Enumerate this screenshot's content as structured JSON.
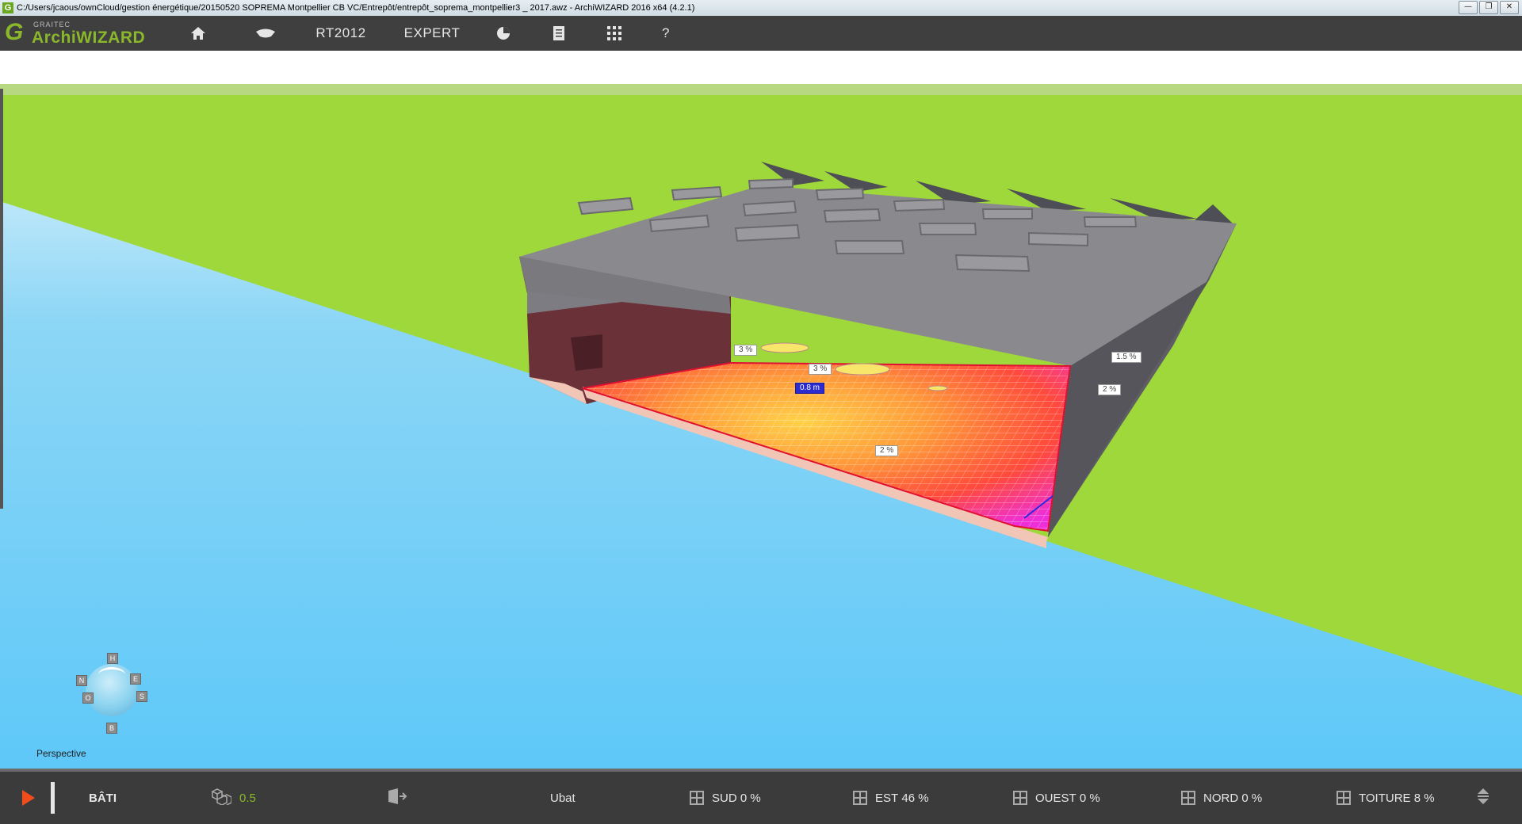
{
  "window": {
    "title": "C:/Users/jcaous/ownCloud/gestion énergétique/20150520 SOPREMA Montpellier CB VC/Entrepôt/entrepôt_soprema_montpellier3 _ 2017.awz  -  ArchiWIZARD 2016 x64 (4.2.1)",
    "buttons": [
      "—",
      "❐",
      "✕"
    ]
  },
  "logo": {
    "brand": "GRAITEC",
    "name": "ArchiWIZARD",
    "letter": "G"
  },
  "toolbar": {
    "items": [
      {
        "icon": "home-icon"
      },
      {
        "icon": "eye-icon"
      },
      {
        "label": "RT2012"
      },
      {
        "label": "EXPERT"
      },
      {
        "icon": "pie-chart-icon"
      },
      {
        "icon": "document-icon"
      },
      {
        "icon": "grid-icon"
      },
      {
        "label": "?"
      }
    ]
  },
  "viewport": {
    "colors": {
      "ground": "#9fd83a",
      "sky_top": "#eaf6fc",
      "sky": "#5ec8f8",
      "roof": "#8a8a8e",
      "wall": "#5e5e64",
      "facade": "#6b3138"
    },
    "labels": {
      "tag1": "3 %",
      "tag2": "3 %",
      "tag3": "0.8 m",
      "tag4": "1.5 %",
      "tag5": "2 %",
      "tag6": "2 %"
    },
    "compass": {
      "top": "H",
      "north": "N",
      "east": "E",
      "west": "O",
      "south": "S",
      "bottom": "B"
    },
    "view_mode": "Perspective"
  },
  "bottombar": {
    "mode": "BÂTI",
    "value": "0.5",
    "ubat": "Ubat",
    "facades": [
      {
        "name": "SUD",
        "value": "0 %"
      },
      {
        "name": "EST",
        "value": "46 %"
      },
      {
        "name": "OUEST",
        "value": "0 %"
      },
      {
        "name": "NORD",
        "value": "0 %"
      },
      {
        "name": "TOITURE",
        "value": "8 %"
      }
    ]
  }
}
